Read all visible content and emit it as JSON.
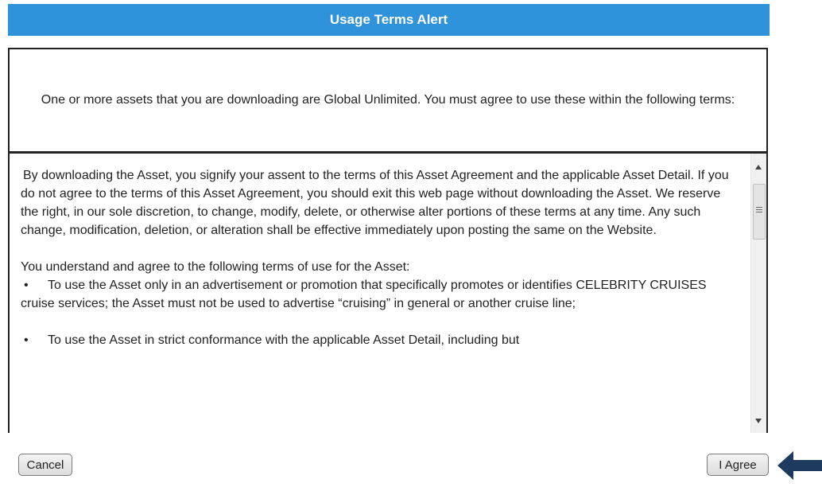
{
  "dialog": {
    "title": "Usage Terms Alert",
    "intro": "One or more assets that you are downloading are Global Unlimited. You must agree to use these within the following terms:",
    "terms": {
      "paragraph1": "By downloading the Asset, you signify your assent to the terms of this Asset Agreement and the applicable Asset Detail.  If you do not agree to the terms of this Asset Agreement, you should exit this web page without downloading the Asset.  We reserve the right, in our sole discretion, to change, modify, delete, or otherwise alter portions of these terms at any time. Any such change, modification, deletion, or alteration shall be effective immediately upon posting the same on the Website.",
      "paragraph2": "You understand and agree to the following terms of use for the Asset:",
      "bullet_symbol": "•",
      "bullets": [
        "To use the Asset only in an advertisement or promotion that specifically promotes or identifies CELEBRITY CRUISES cruise services; the Asset must not be used to advertise “cruising” in general or another cruise line;",
        "To use the Asset in strict conformance with the applicable Asset Detail, including but"
      ]
    },
    "buttons": {
      "cancel_label": "Cancel",
      "agree_label": "I Agree"
    }
  },
  "icons": {
    "scroll_up": "scroll-up-arrow-icon",
    "scroll_down": "scroll-down-arrow-icon",
    "pointer_arrow": "left-arrow-icon"
  },
  "colors": {
    "title_bar": "#2e93db",
    "title_text": "#ffffff",
    "arrow": "#1f3a5f"
  }
}
